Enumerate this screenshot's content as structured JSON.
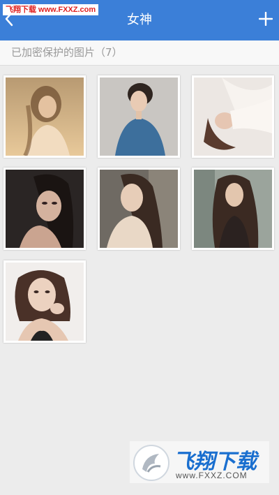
{
  "watermark": {
    "top_text": "飞翔下载 www.FXXZ.com",
    "bottom_name": "飞翔下载",
    "bottom_url": "www.FXXZ.COM"
  },
  "header": {
    "title": "女神",
    "back_icon": "chevron-left-icon",
    "add_icon": "plus-icon",
    "background_color": "#3b7fd8"
  },
  "subtitle": {
    "text": "已加密保护的图片（7）"
  },
  "gallery": {
    "photos": [
      {
        "icon": "photo-thumbnail-1"
      },
      {
        "icon": "photo-thumbnail-2"
      },
      {
        "icon": "photo-thumbnail-3"
      },
      {
        "icon": "photo-thumbnail-4"
      },
      {
        "icon": "photo-thumbnail-5"
      },
      {
        "icon": "photo-thumbnail-6"
      },
      {
        "icon": "photo-thumbnail-7"
      }
    ]
  }
}
